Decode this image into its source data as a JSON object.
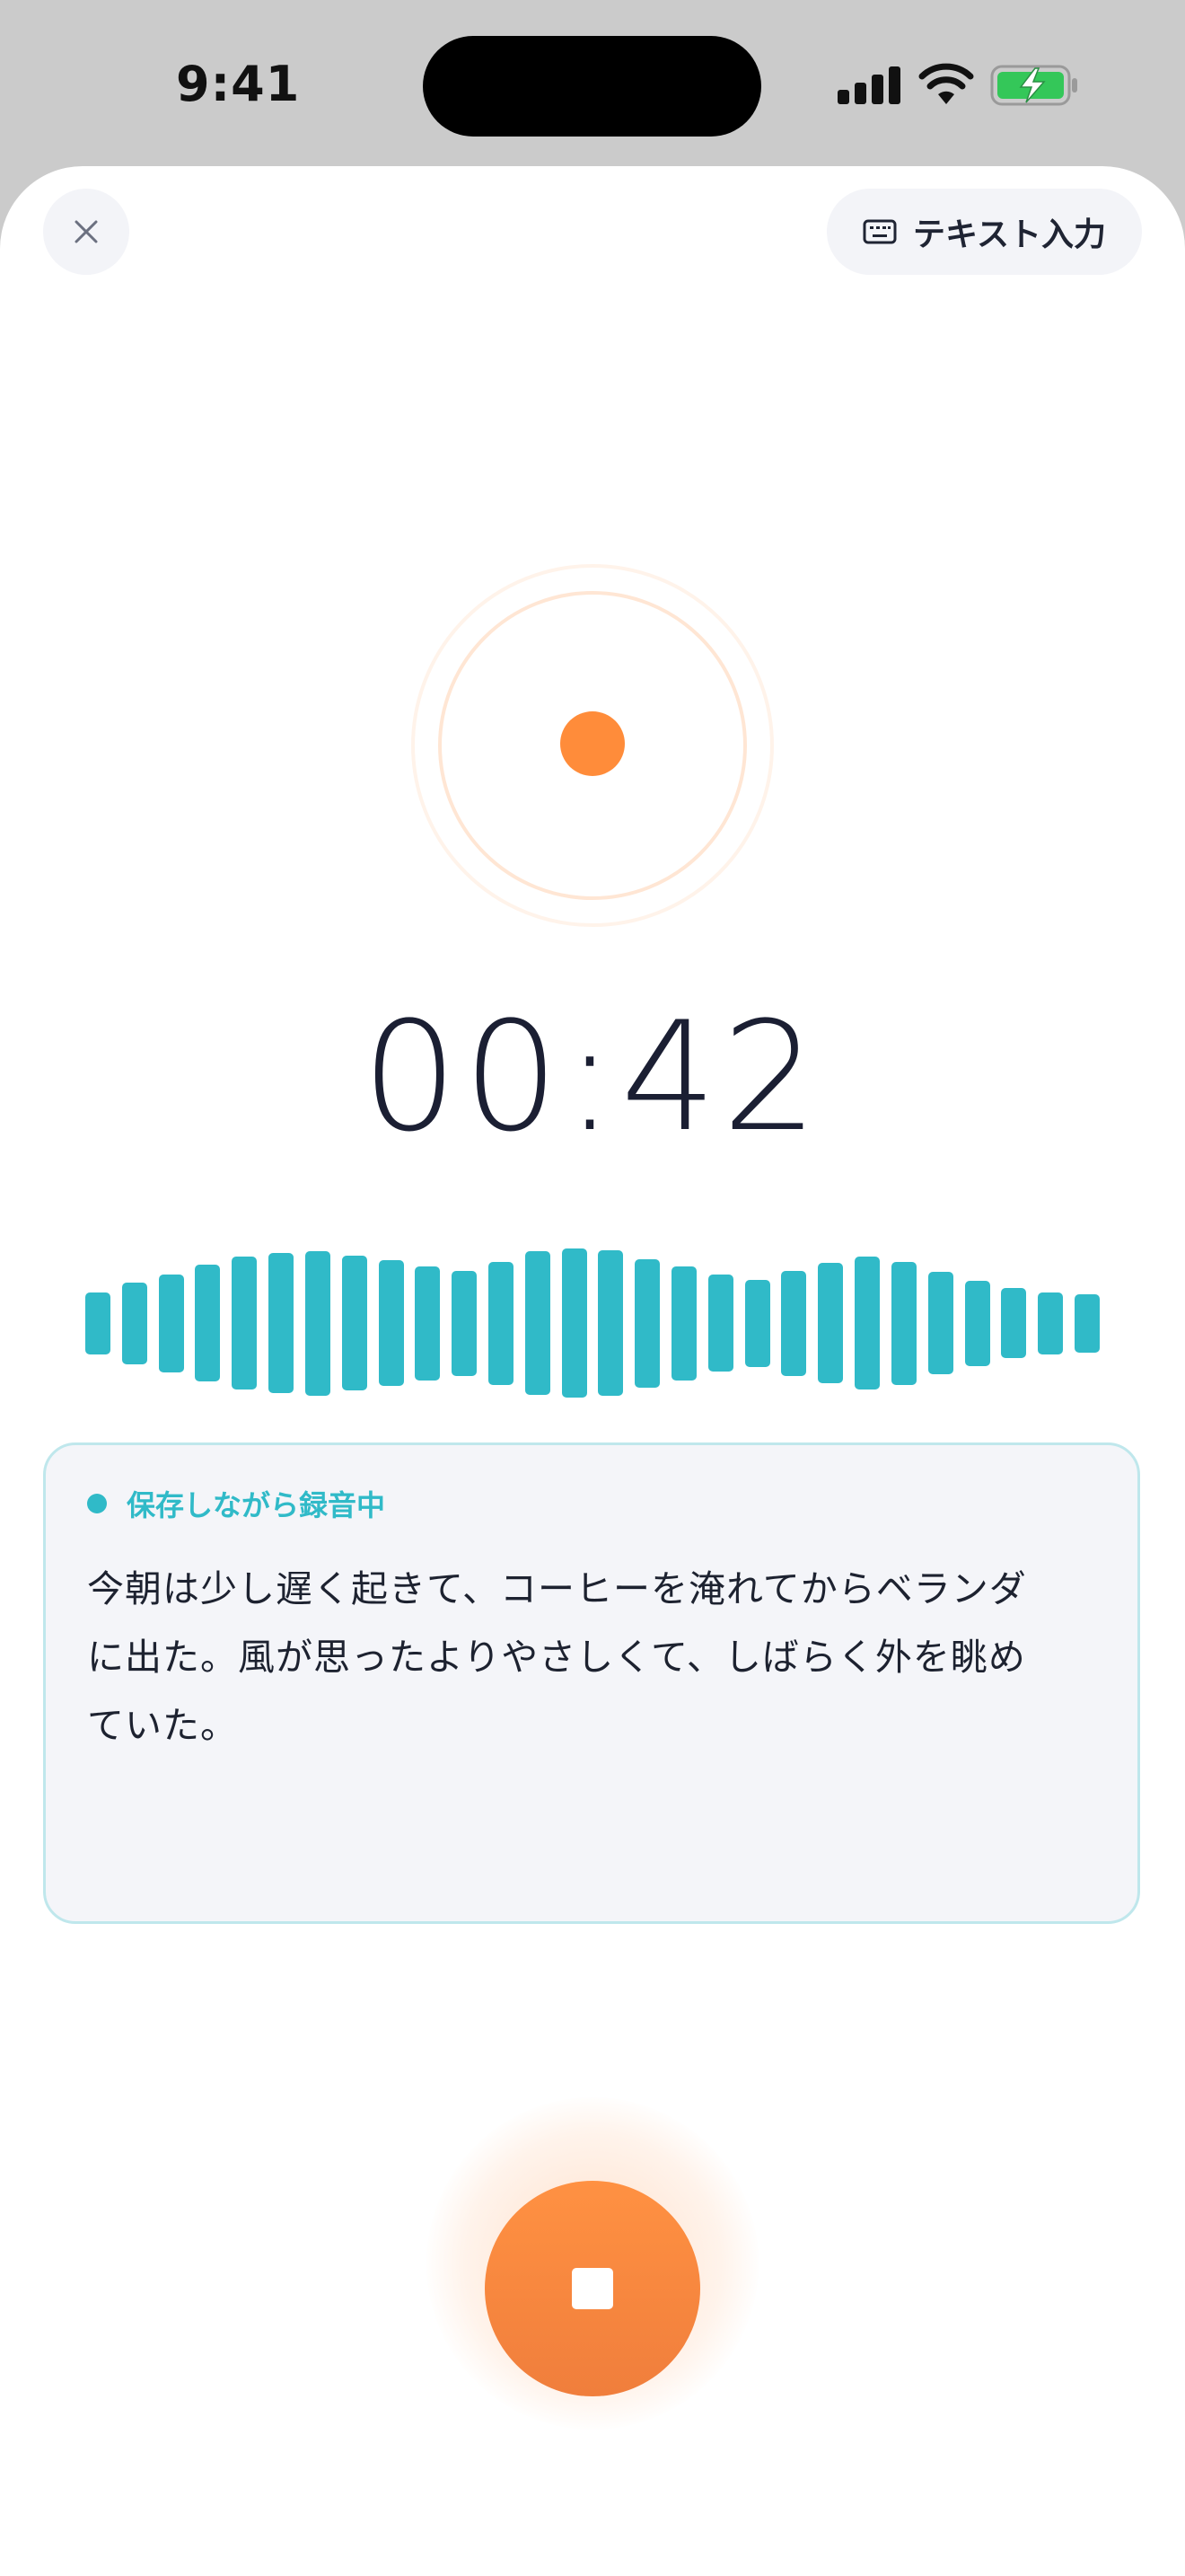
{
  "status_bar": {
    "time": "9:41"
  },
  "header": {
    "close_icon": "close-icon",
    "text_input_label": "テキスト入力",
    "keyboard_icon": "keyboard-icon"
  },
  "recording": {
    "timer": "00:42",
    "indicator_color": "#ff8c3a",
    "waveform_color": "#30bac8",
    "waveform_levels": [
      0.25,
      0.42,
      0.56,
      0.72,
      0.86,
      0.92,
      0.96,
      0.88,
      0.8,
      0.7,
      0.62,
      0.78,
      0.95,
      1.0,
      0.97,
      0.82,
      0.7,
      0.55,
      0.47,
      0.62,
      0.75,
      0.86,
      0.78,
      0.6,
      0.45,
      0.32,
      0.25,
      0.22
    ]
  },
  "transcript": {
    "status_label": "保存しながら録音中",
    "lines": [
      "今朝は少し遅く起きて、コーヒーを淹れてからベランダ",
      "に出た。風が思ったよりやさしくて、しばらく外を眺め",
      "ていた。"
    ]
  },
  "controls": {
    "stop_icon": "stop-icon",
    "accent_color": "#f58a3e"
  }
}
